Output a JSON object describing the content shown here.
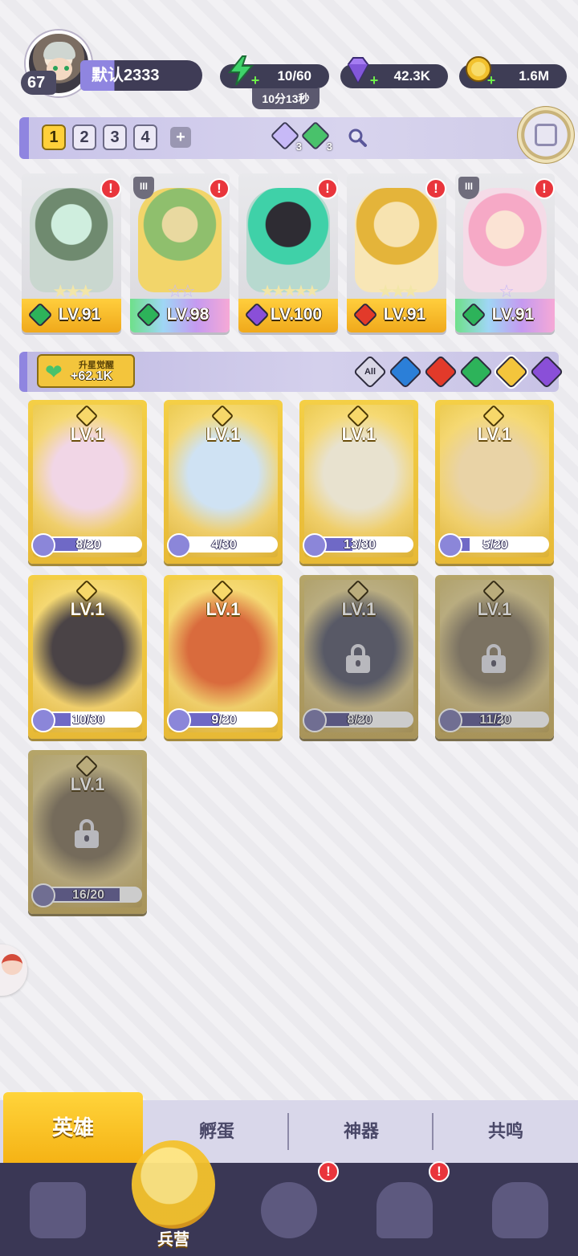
{
  "player": {
    "level": "67",
    "name": "默认2333"
  },
  "resources": {
    "energy": {
      "value": "10/60",
      "timer": "10分13秒",
      "icon": "lightning-icon",
      "color": "#3fd36a"
    },
    "gems": {
      "value": "42.3K",
      "icon": "diamond-icon",
      "color": "#a57cf2"
    },
    "gold": {
      "value": "1.6M",
      "icon": "coin-icon",
      "color": "#f2c12e"
    }
  },
  "team_selector": {
    "teams": [
      "1",
      "2",
      "3",
      "4"
    ],
    "active_team": "1",
    "add_label": "+",
    "gem_chips": [
      {
        "count": "3",
        "color": "#c7b9f7"
      },
      {
        "count": "3",
        "color": "#49c26b"
      }
    ]
  },
  "team_heroes": [
    {
      "level": "LV.91",
      "stars": "★★★",
      "element": "nature",
      "element_color": "#2db35a",
      "alert": "!",
      "rainbow": false,
      "shield": ""
    },
    {
      "level": "LV.98",
      "stars": "☆☆",
      "element": "nature",
      "element_color": "#2db35a",
      "alert": "!",
      "rainbow": true,
      "shield": "III"
    },
    {
      "level": "LV.100",
      "stars": "★★★★★",
      "element": "dark",
      "element_color": "#8a4fd8",
      "alert": "!",
      "rainbow": false,
      "shield": ""
    },
    {
      "level": "LV.91",
      "stars": "★★★",
      "element": "fire",
      "element_color": "#e23a2a",
      "alert": "!",
      "rainbow": false,
      "shield": ""
    },
    {
      "level": "LV.91",
      "stars": "☆",
      "element": "nature",
      "element_color": "#2db35a",
      "alert": "!",
      "rainbow": true,
      "shield": "III"
    }
  ],
  "awaken": {
    "title": "升星觉醒",
    "value": "+62.1K"
  },
  "filters": [
    {
      "label": "All",
      "color": "#d9d7e6"
    },
    {
      "label": "",
      "color": "#2b7fd8"
    },
    {
      "label": "",
      "color": "#e23a2a"
    },
    {
      "label": "",
      "color": "#2db35a"
    },
    {
      "label": "",
      "color": "#f3c53c"
    },
    {
      "label": "",
      "color": "#8a4fd8"
    }
  ],
  "roster": [
    {
      "level": "LV.1",
      "progress": "8/20",
      "fraction": 0.4,
      "locked": false,
      "art": "#f1d6e6"
    },
    {
      "level": "LV.1",
      "progress": "4/30",
      "fraction": 0.13,
      "locked": false,
      "art": "#cfe2f3"
    },
    {
      "level": "LV.1",
      "progress": "13/30",
      "fraction": 0.43,
      "locked": false,
      "art": "#e8e2cf"
    },
    {
      "level": "LV.1",
      "progress": "5/20",
      "fraction": 0.25,
      "locked": false,
      "art": "#e9d3a6"
    },
    {
      "level": "LV.1",
      "progress": "10/30",
      "fraction": 0.33,
      "locked": false,
      "art": "#4a4346"
    },
    {
      "level": "LV.1",
      "progress": "9/20",
      "fraction": 0.45,
      "locked": false,
      "art": "#d96b3d"
    },
    {
      "level": "LV.1",
      "progress": "8/20",
      "fraction": 0.4,
      "locked": true,
      "art": "#6b6f8d"
    },
    {
      "level": "LV.1",
      "progress": "11/20",
      "fraction": 0.55,
      "locked": true,
      "art": "#a28e6a"
    },
    {
      "level": "LV.1",
      "progress": "16/20",
      "fraction": 0.8,
      "locked": true,
      "art": "#9b8560"
    }
  ],
  "sub_tabs": [
    "英雄",
    "孵蛋",
    "神器",
    "共鸣"
  ],
  "nav": {
    "items": [
      {
        "name": "cards",
        "label": "",
        "alert": ""
      },
      {
        "name": "barracks",
        "label": "兵营",
        "alert": ""
      },
      {
        "name": "quests",
        "label": "",
        "alert": "!"
      },
      {
        "name": "shop",
        "label": "",
        "alert": "!"
      },
      {
        "name": "guild",
        "label": "",
        "alert": ""
      }
    ]
  }
}
